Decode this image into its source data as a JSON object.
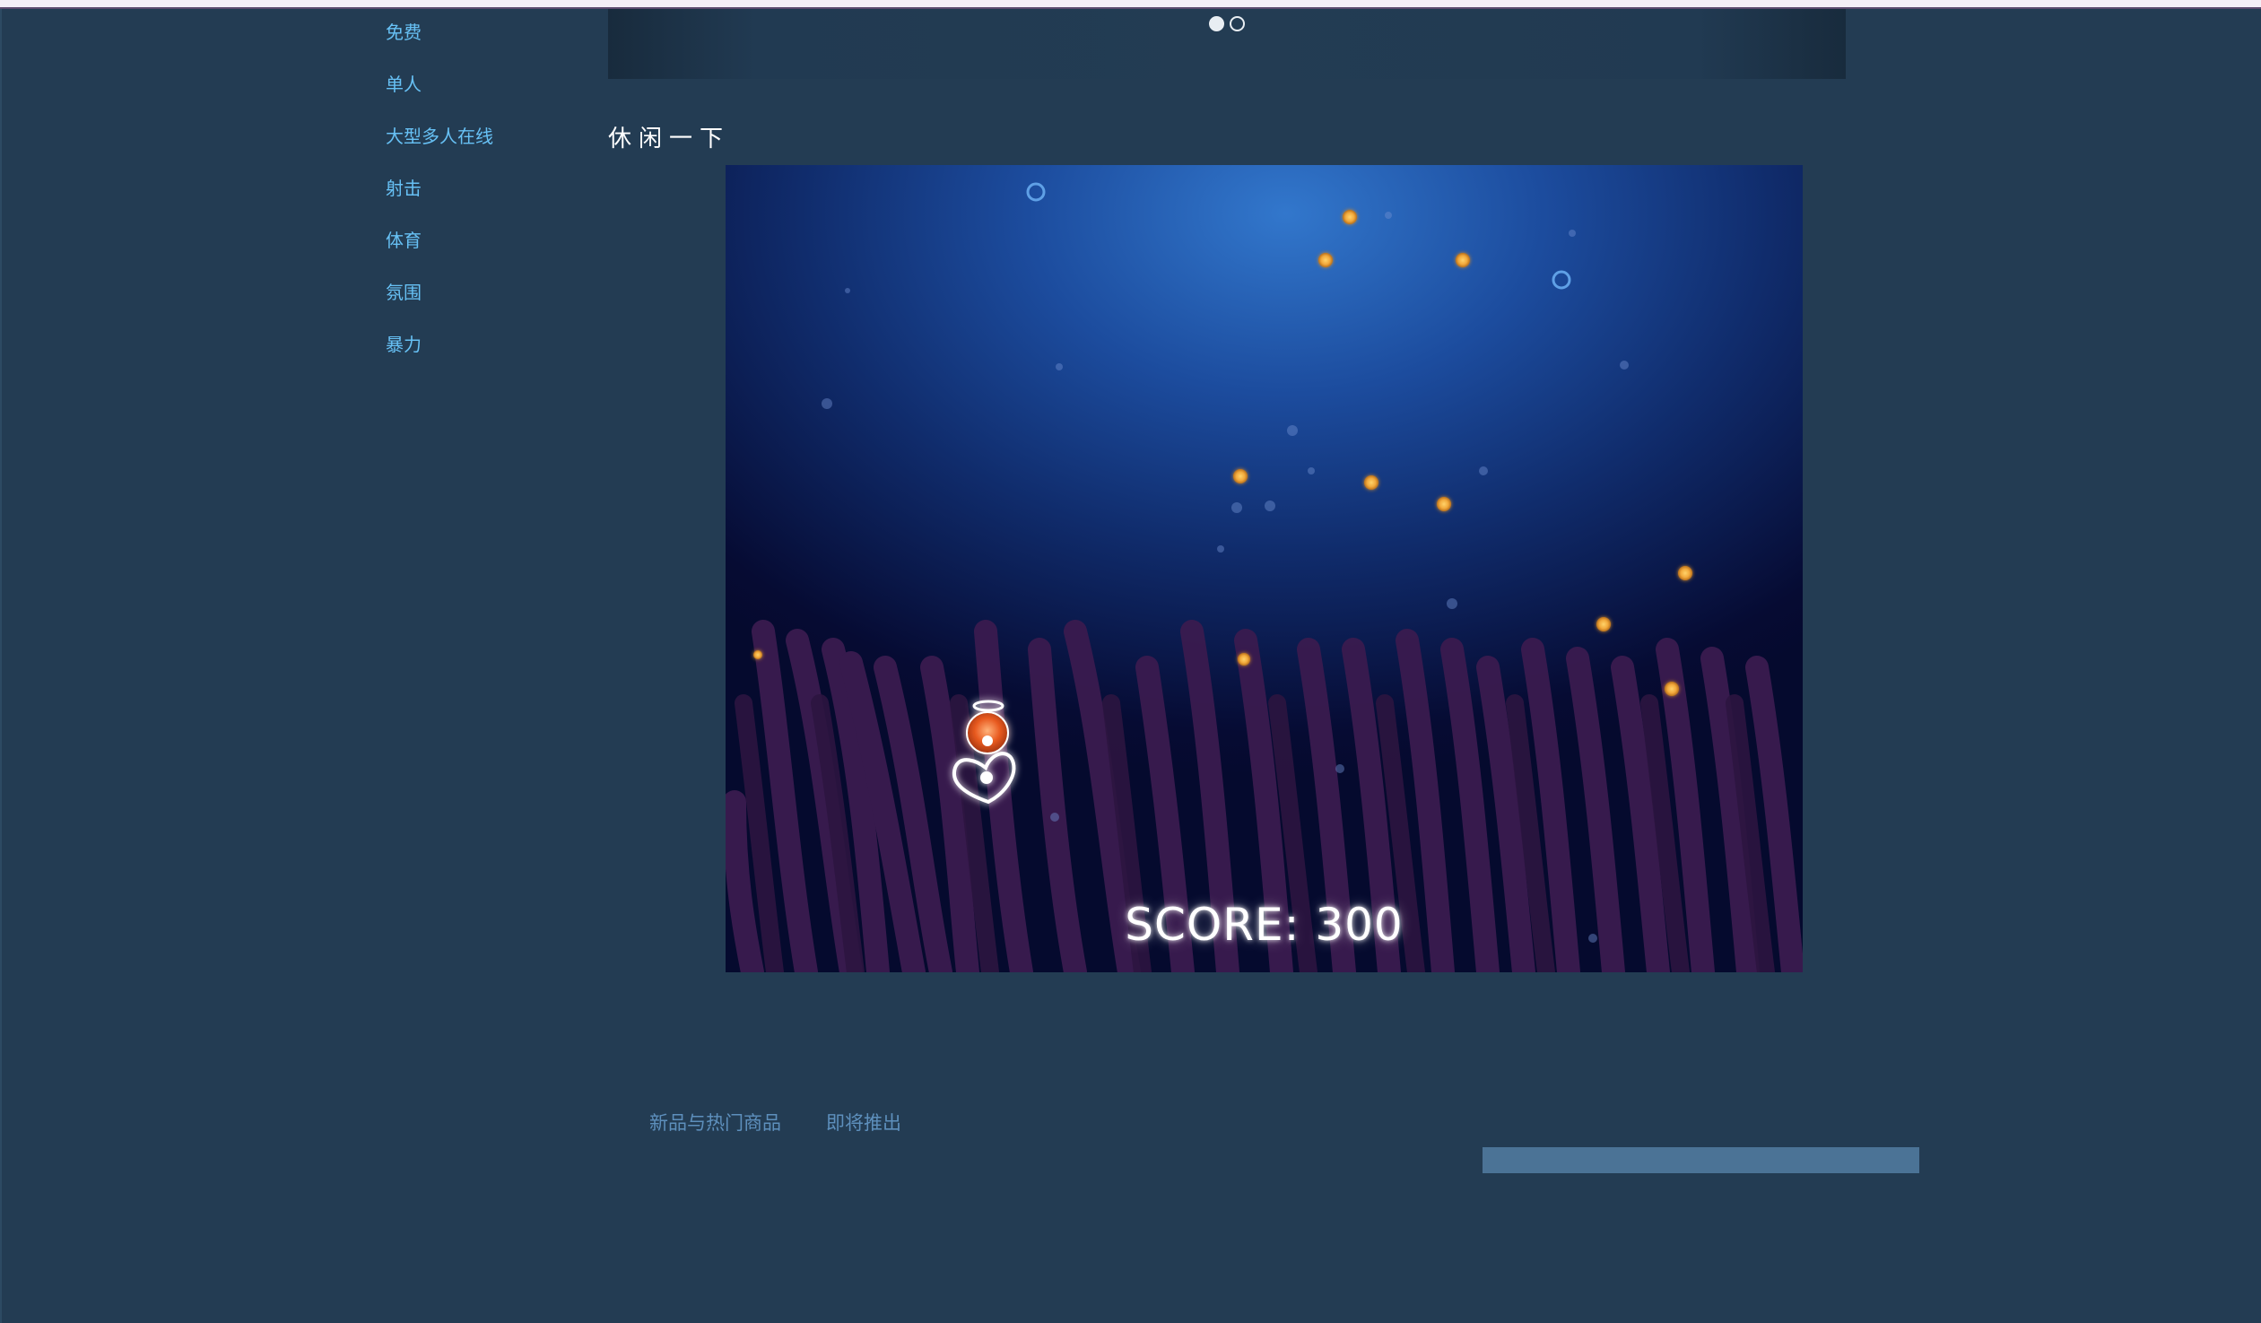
{
  "sidebar": {
    "items": [
      {
        "label": "免费"
      },
      {
        "label": "单人"
      },
      {
        "label": "大型多人在线"
      },
      {
        "label": "射击"
      },
      {
        "label": "体育"
      },
      {
        "label": "氛围"
      },
      {
        "label": "暴力"
      }
    ]
  },
  "carousel": {
    "page_count": 2,
    "active_index": 0
  },
  "section": {
    "title": "休闲一下"
  },
  "game": {
    "score_text": "SCORE: 300",
    "colors": {
      "sky_top": "#3277cc",
      "sky_bottom": "#050a2e",
      "seaweed": "#3a1b4f",
      "orb": "#f2a93b",
      "bubble": "#5fa0e6"
    },
    "player": {
      "icon": "heart-outline-icon",
      "companion": "orange-orb-icon"
    }
  },
  "tabs": [
    {
      "label": "新品与热门商品"
    },
    {
      "label": "即将推出"
    }
  ]
}
